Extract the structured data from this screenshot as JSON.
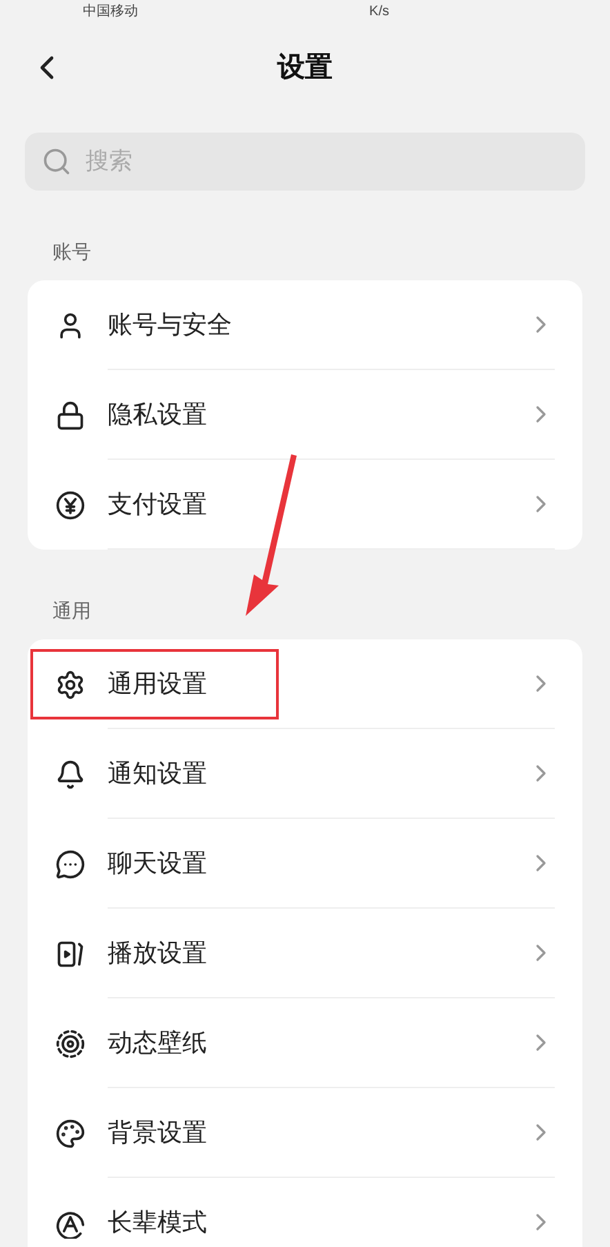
{
  "status_bar": {
    "carrier": "中国移动",
    "speed": "K/s"
  },
  "header": {
    "title": "设置"
  },
  "search": {
    "placeholder": "搜索"
  },
  "sections": [
    {
      "title": "账号",
      "items": [
        {
          "label": "账号与安全",
          "highlighted": false
        },
        {
          "label": "隐私设置",
          "highlighted": false
        },
        {
          "label": "支付设置",
          "highlighted": false
        }
      ]
    },
    {
      "title": "通用",
      "items": [
        {
          "label": "通用设置",
          "highlighted": true
        },
        {
          "label": "通知设置",
          "highlighted": false
        },
        {
          "label": "聊天设置",
          "highlighted": false
        },
        {
          "label": "播放设置",
          "highlighted": false
        },
        {
          "label": "动态壁纸",
          "highlighted": false
        },
        {
          "label": "背景设置",
          "highlighted": false
        },
        {
          "label": "长辈模式",
          "highlighted": false
        }
      ]
    }
  ]
}
